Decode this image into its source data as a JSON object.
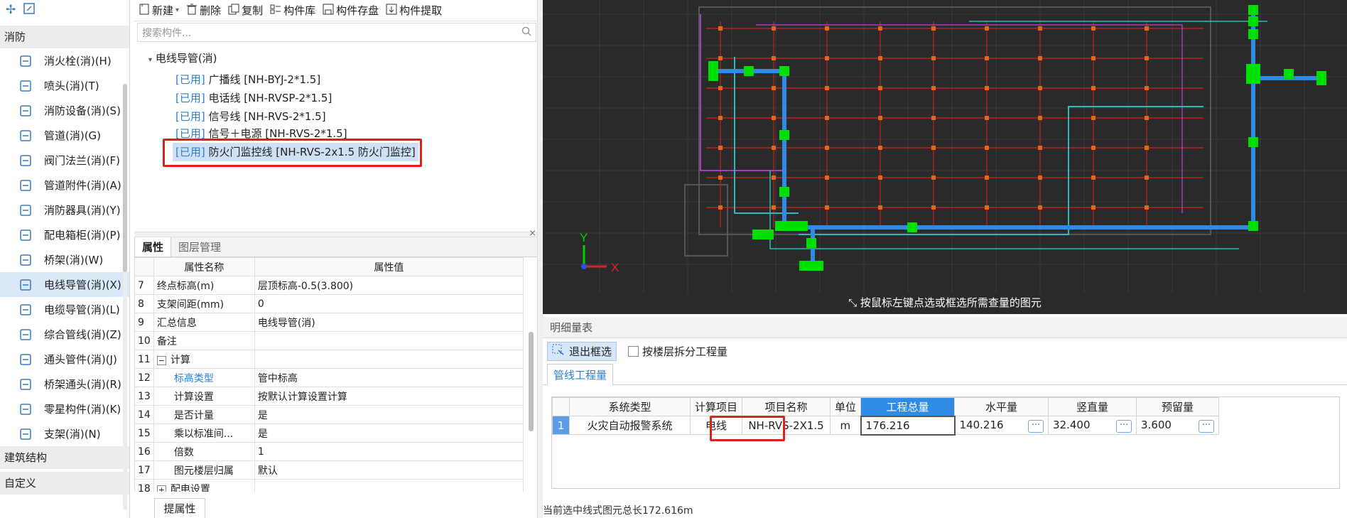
{
  "left_nav": {
    "category_fire": "消防",
    "items": [
      {
        "label": "消火栓(消)(H)",
        "icon": "hydrant-icon"
      },
      {
        "label": "喷头(消)(T)",
        "icon": "sprinkler-icon"
      },
      {
        "label": "消防设备(消)(S)",
        "icon": "fire-equipment-icon"
      },
      {
        "label": "管道(消)(G)",
        "icon": "pipe-icon"
      },
      {
        "label": "阀门法兰(消)(F)",
        "icon": "valve-icon"
      },
      {
        "label": "管道附件(消)(A)",
        "icon": "pipe-fitting-icon"
      },
      {
        "label": "消防器具(消)(Y)",
        "icon": "fire-device-icon"
      },
      {
        "label": "配电箱柜(消)(P)",
        "icon": "distribution-box-icon"
      },
      {
        "label": "桥架(消)(W)",
        "icon": "cable-tray-icon"
      },
      {
        "label": "电线导管(消)(X)",
        "icon": "conduit-icon"
      },
      {
        "label": "电缆导管(消)(L)",
        "icon": "cable-conduit-icon"
      },
      {
        "label": "综合管线(消)(Z)",
        "icon": "combined-pipeline-icon"
      },
      {
        "label": "通头管件(消)(J)",
        "icon": "tee-fitting-icon"
      },
      {
        "label": "桥架通头(消)(R)",
        "icon": "tray-tee-icon"
      },
      {
        "label": "零星构件(消)(K)",
        "icon": "misc-component-icon"
      },
      {
        "label": "支架(消)(N)",
        "icon": "bracket-icon"
      }
    ],
    "category_structure": "建筑结构",
    "category_custom": "自定义"
  },
  "toolbar": {
    "new": "新建",
    "delete": "删除",
    "copy": "复制",
    "library": "构件库",
    "save": "构件存盘",
    "extract": "构件提取"
  },
  "search": {
    "placeholder": "搜索构件..."
  },
  "tree": {
    "group": "电线导管(消)",
    "used_tag": "[已用]",
    "items": [
      "广播线 [NH-BYJ-2*1.5]",
      "电话线 [NH-RVSP-2*1.5]",
      "信号线 [NH-RVS-2*1.5]",
      "信号＋电源 [NH-RVS-2*1.5]",
      "防火门监控线 [NH-RVS-2x1.5 防火门监控]"
    ]
  },
  "properties": {
    "tab_props": "属性",
    "tab_layers": "图层管理",
    "col_name": "属性名称",
    "col_value": "属性值",
    "rows": [
      {
        "no": "7",
        "name": "终点标高(m)",
        "value": "层顶标高-0.5(3.800)"
      },
      {
        "no": "8",
        "name": "支架间距(mm)",
        "value": "0"
      },
      {
        "no": "9",
        "name": "汇总信息",
        "value": "电线导管(消)"
      },
      {
        "no": "10",
        "name": "备注",
        "value": ""
      },
      {
        "no": "11",
        "name": "计算",
        "value": ""
      },
      {
        "no": "12",
        "name": "标高类型",
        "value": "管中标高"
      },
      {
        "no": "13",
        "name": "计算设置",
        "value": "按默认计算设置计算"
      },
      {
        "no": "14",
        "name": "是否计量",
        "value": "是"
      },
      {
        "no": "15",
        "name": "乘以标准间...",
        "value": "是"
      },
      {
        "no": "16",
        "name": "倍数",
        "value": "1"
      },
      {
        "no": "17",
        "name": "图元楼层归属",
        "value": "默认"
      },
      {
        "no": "18",
        "name": "配电设置",
        "value": ""
      }
    ],
    "bottom_tab": "提属性"
  },
  "canvas": {
    "hint": "按鼠标左键点选或框选所需查量的图元",
    "axis_x": "X",
    "axis_y": "Y"
  },
  "detail": {
    "title": "明细量表",
    "exit_select": "退出框选",
    "split_floor": "按楼层拆分工程量",
    "tab": "管线工程量",
    "headers": [
      "系统类型",
      "计算项目",
      "项目名称",
      "单位",
      "工程总量",
      "水平量",
      "竖直量",
      "预留量"
    ],
    "row": {
      "idx": "1",
      "system": "火灾自动报警系统",
      "item": "电线",
      "name": "NH-RVS-2X1.5",
      "unit": "m",
      "total": "176.216",
      "horizontal": "140.216",
      "vertical": "32.400",
      "reserve": "3.600"
    },
    "status": "当前选中线式图元总长172.616m"
  },
  "colors": {
    "accent": "#2f8be6",
    "highlight_red": "#e0201b",
    "used_blue": "#2f7fd0",
    "canvas_bg": "#2a2a2a",
    "pipe_blue": "#2f8be6",
    "node_green": "#00e000"
  }
}
